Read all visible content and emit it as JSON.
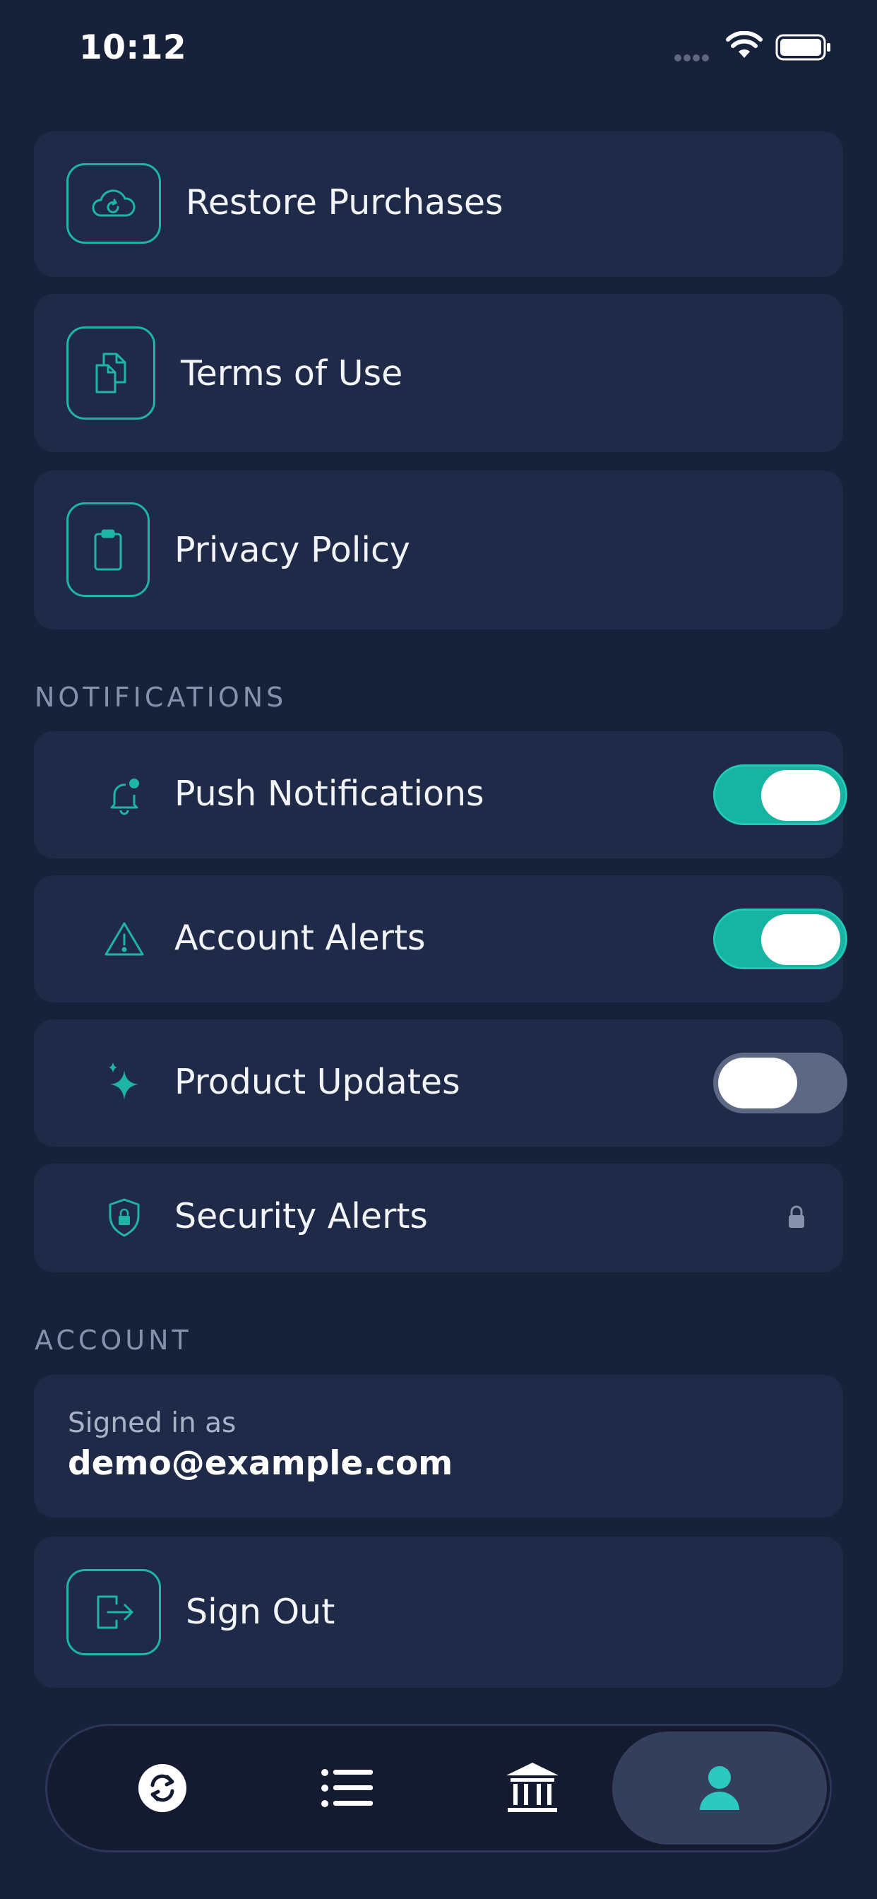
{
  "status_bar": {
    "time": "10:12"
  },
  "links": [
    {
      "label": "Restore Purchases",
      "icon": "cloud-refresh-icon"
    },
    {
      "label": "Terms of Use",
      "icon": "documents-icon"
    },
    {
      "label": "Privacy Policy",
      "icon": "clipboard-icon"
    }
  ],
  "notifications": {
    "title": "NOTIFICATIONS",
    "items": [
      {
        "label": "Push Notifications",
        "icon": "bell-icon",
        "enabled": true
      },
      {
        "label": "Account Alerts",
        "icon": "warning-icon",
        "enabled": true
      },
      {
        "label": "Product Updates",
        "icon": "sparkles-icon",
        "enabled": false
      },
      {
        "label": "Security Alerts",
        "icon": "shield-lock-icon",
        "locked": true
      }
    ]
  },
  "account": {
    "title": "ACCOUNT",
    "signed_in_label": "Signed in as",
    "email": "demo@example.com",
    "sign_out_label": "Sign Out"
  },
  "tab_bar": {
    "tabs": [
      {
        "name": "transfer",
        "icon": "transfer-icon",
        "active": false
      },
      {
        "name": "list",
        "icon": "list-icon",
        "active": false
      },
      {
        "name": "bank",
        "icon": "bank-icon",
        "active": false
      },
      {
        "name": "profile",
        "icon": "person-icon",
        "active": true
      }
    ]
  },
  "colors": {
    "background": "#18213a",
    "card": "#1f2a48",
    "accent": "#1fb5a5",
    "toggle_off": "#5d6884",
    "section_title": "#8591ad"
  }
}
